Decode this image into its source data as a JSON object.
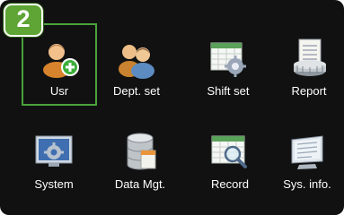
{
  "step_badge": "2",
  "colors": {
    "screen_bg": "#111111",
    "selection_border": "#49a33a",
    "badge_bg": "#5ea535",
    "label_text": "#ffffff"
  },
  "menu": {
    "selected": "Usr",
    "items": [
      {
        "label": "Usr",
        "icon": "user-add-icon"
      },
      {
        "label": "Dept. set",
        "icon": "department-users-icon"
      },
      {
        "label": "Shift set",
        "icon": "shift-calendar-gear-icon"
      },
      {
        "label": "Report",
        "icon": "report-scroll-icon"
      },
      {
        "label": "System",
        "icon": "system-monitor-gear-icon"
      },
      {
        "label": "Data Mgt.",
        "icon": "database-icon"
      },
      {
        "label": "Record",
        "icon": "record-search-icon"
      },
      {
        "label": "Sys. info.",
        "icon": "system-info-monitor-icon"
      }
    ]
  }
}
